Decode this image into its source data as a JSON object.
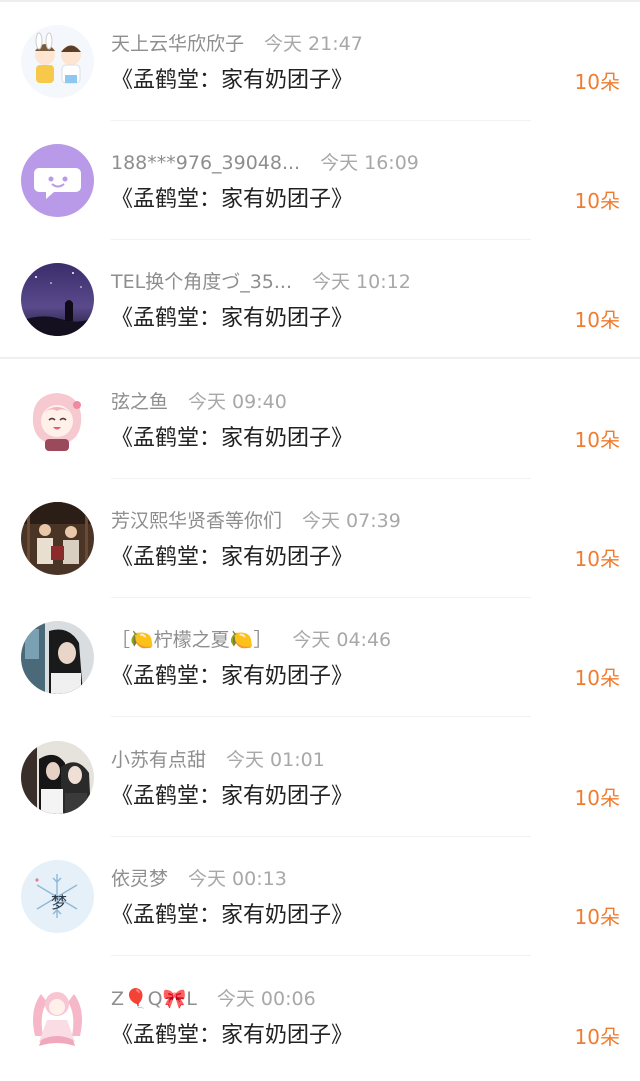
{
  "gifts": [
    {
      "name": "天上云华欣欣子",
      "time": "今天 21:47",
      "title": "《孟鹤堂：家有奶团子》",
      "amount": "10朵",
      "avatar_icon": "cartoon-kids-avatar"
    },
    {
      "name": "188***976_39048...",
      "time": "今天 16:09",
      "title": "《孟鹤堂：家有奶团子》",
      "amount": "10朵",
      "avatar_icon": "default-chat-avatar"
    },
    {
      "name": "TEL换个角度づ_35...",
      "time": "今天 10:12",
      "title": "《孟鹤堂：家有奶团子》",
      "amount": "10朵",
      "avatar_icon": "night-sky-avatar"
    },
    {
      "name": "弦之鱼",
      "time": "今天 09:40",
      "title": "《孟鹤堂：家有奶团子》",
      "amount": "10朵",
      "avatar_icon": "anime-girl-avatar"
    },
    {
      "name": "芳汉熙华贤香等你们",
      "time": "今天 07:39",
      "title": "《孟鹤堂：家有奶团子》",
      "amount": "10朵",
      "avatar_icon": "stage-photo-avatar"
    },
    {
      "name": "［🍋柠檬之夏🍋］",
      "time": "今天 04:46",
      "title": "《孟鹤堂：家有奶团子》",
      "amount": "10朵",
      "avatar_icon": "girl-photo-avatar"
    },
    {
      "name": "小苏有点甜",
      "time": "今天 01:01",
      "title": "《孟鹤堂：家有奶团子》",
      "amount": "10朵",
      "avatar_icon": "couple-photo-avatar"
    },
    {
      "name": "依灵梦",
      "time": "今天 00:13",
      "title": "《孟鹤堂：家有奶团子》",
      "amount": "10朵",
      "avatar_icon": "dream-snowflake-avatar"
    },
    {
      "name": "Z🎈Q🎀L",
      "time": "今天 00:06",
      "title": "《孟鹤堂：家有奶团子》",
      "amount": "10朵",
      "avatar_icon": "pink-anime-avatar"
    }
  ],
  "colors": {
    "amount": "#f07c30",
    "meta": "#999999",
    "title": "#222222",
    "avatar_purple": "#b89ae8"
  }
}
